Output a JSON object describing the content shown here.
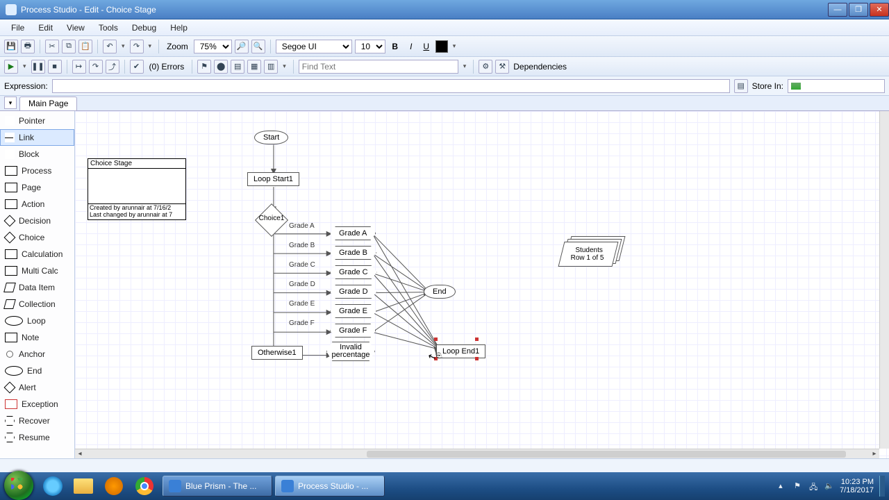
{
  "window": {
    "title": "Process Studio  -  Edit  -  Choice Stage"
  },
  "menu": {
    "file": "File",
    "edit": "Edit",
    "view": "View",
    "tools": "Tools",
    "debug": "Debug",
    "help": "Help"
  },
  "toolbar": {
    "zoom_label": "Zoom",
    "zoom_value": "75%",
    "font_name": "Segoe UI",
    "font_size": "10",
    "errors": "(0) Errors",
    "find_placeholder": "Find Text",
    "dependencies": "Dependencies"
  },
  "expr": {
    "label": "Expression:",
    "value": "",
    "store_label": "Store In:"
  },
  "tabs": {
    "main": "Main Page"
  },
  "tools": [
    "Pointer",
    "Link",
    "Block",
    "Process",
    "Page",
    "Action",
    "Decision",
    "Choice",
    "Calculation",
    "Multi Calc",
    "Data Item",
    "Collection",
    "Loop",
    "Note",
    "Anchor",
    "End",
    "Alert",
    "Exception",
    "Recover",
    "Resume"
  ],
  "tool_selected": 1,
  "infobox": {
    "title": "Choice Stage",
    "created": "Created by arunnair at 7/16/2",
    "changed": "Last changed by arunnair at 7"
  },
  "stages": {
    "start": "Start",
    "loop_start": "Loop Start1",
    "choice": "Choice1",
    "end": "End",
    "loop_end": "Loop End1",
    "otherwise": "Otherwise1",
    "invalid": "Invalid percentage"
  },
  "branches": {
    "labels": [
      "Grade A",
      "Grade B",
      "Grade C",
      "Grade D",
      "Grade E",
      "Grade F"
    ],
    "targets": [
      "Grade A",
      "Grade B",
      "Grade C",
      "Grade D",
      "Grade E",
      "Grade F"
    ]
  },
  "collection": {
    "name": "Students",
    "row": "Row 1 of 5"
  },
  "taskbar": {
    "btn1": "Blue Prism - The ...",
    "btn2": "Process Studio - ...",
    "time": "10:23 PM",
    "date": "7/18/2017"
  }
}
